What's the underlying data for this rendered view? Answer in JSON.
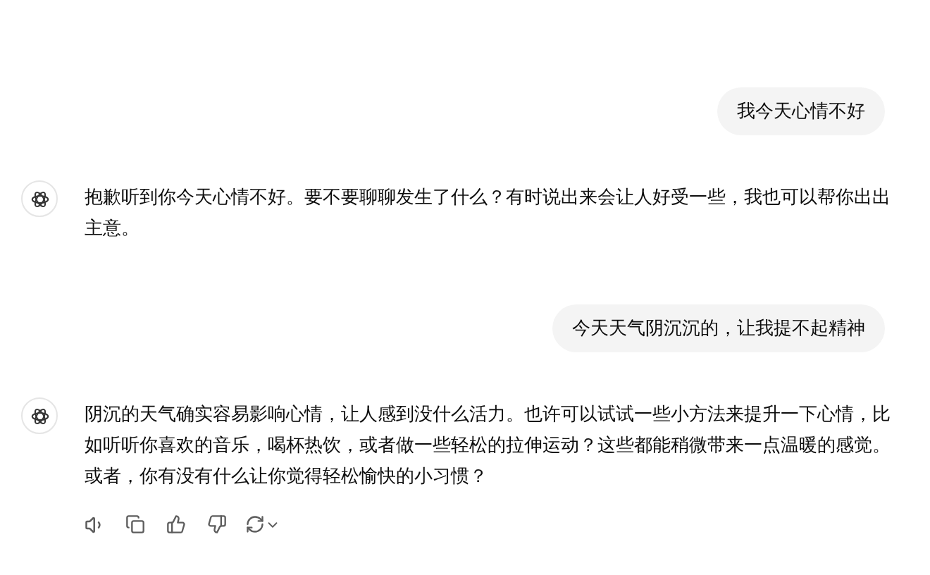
{
  "messages": [
    {
      "kind": "user",
      "text": "我今天心情不好"
    },
    {
      "kind": "assistant",
      "text": "抱歉听到你今天心情不好。要不要聊聊发生了什么？有时说出来会让人好受一些，我也可以帮你出出主意。",
      "actions": false
    },
    {
      "kind": "user",
      "text": "今天天气阴沉沉的，让我提不起精神"
    },
    {
      "kind": "assistant",
      "text": "阴沉的天气确实容易影响心情，让人感到没什么活力。也许可以试试一些小方法来提升一下心情，比如听听你喜欢的音乐，喝杯热饮，或者做一些轻松的拉伸运动？这些都能稍微带来一点温暖的感觉。或者，你有没有什么让你觉得轻松愉快的小习惯？",
      "actions": true
    }
  ]
}
